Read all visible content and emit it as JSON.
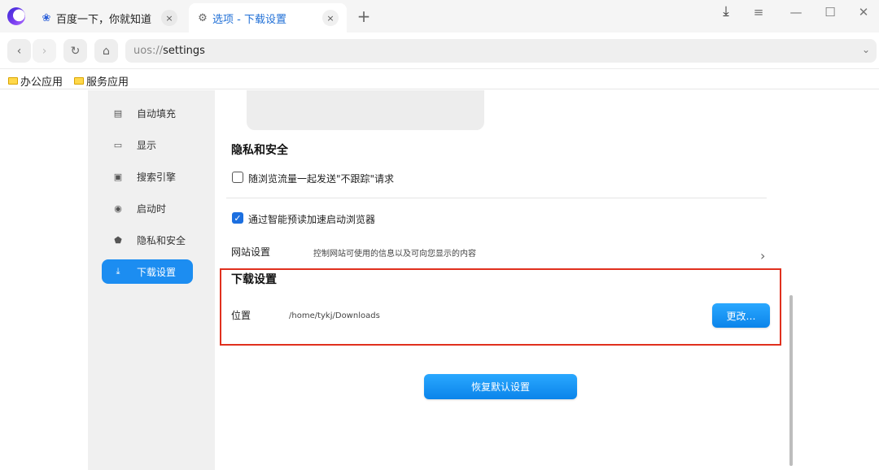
{
  "tabs": [
    {
      "icon": "paw-icon",
      "label": "百度一下，你就知道",
      "close": "×"
    },
    {
      "icon": "gear-icon",
      "label": "选项 - 下载设置",
      "close": "×"
    }
  ],
  "new_tab": "+",
  "window_controls": {
    "download": "⤓",
    "menu": "≡",
    "minimize": "—",
    "maximize": "☐",
    "close": "✕"
  },
  "nav": {
    "back": "‹",
    "forward": "›",
    "reload": "↻",
    "home": "⌂"
  },
  "address": {
    "scheme": "uos://",
    "host": "settings",
    "dropdown": "⌄"
  },
  "bookmarks": [
    {
      "label": "办公应用"
    },
    {
      "label": "服务应用"
    }
  ],
  "sidebar": {
    "items": [
      {
        "icon": "form-icon",
        "glyph": "▤",
        "label": "自动填充",
        "active": false
      },
      {
        "icon": "monitor-icon",
        "glyph": "▭",
        "label": "显示",
        "active": false
      },
      {
        "icon": "search-engine-icon",
        "glyph": "▣",
        "label": "搜索引擎",
        "active": false
      },
      {
        "icon": "power-icon",
        "glyph": "◉",
        "label": "启动时",
        "active": false
      },
      {
        "icon": "shield-icon",
        "glyph": "⬟",
        "label": "隐私和安全",
        "active": false
      },
      {
        "icon": "download-icon",
        "glyph": "⤓",
        "label": "下载设置",
        "active": true
      }
    ]
  },
  "privacy": {
    "title": "隐私和安全",
    "dnt_label": "随浏览流量一起发送\"不跟踪\"请求",
    "dnt_checked": false,
    "preload_label": "通过智能预读加速启动浏览器",
    "preload_checked": true,
    "site_settings_label": "网站设置",
    "site_settings_desc": "控制网站可使用的信息以及可向您显示的内容",
    "chevron": "›"
  },
  "download": {
    "title": "下载设置",
    "location_label": "位置",
    "location_value": "/home/tykj/Downloads",
    "change_button": "更改…"
  },
  "reset_button": "恢复默认设置",
  "colors": {
    "accent": "#1c8df1",
    "highlight_border": "#e0301e"
  }
}
